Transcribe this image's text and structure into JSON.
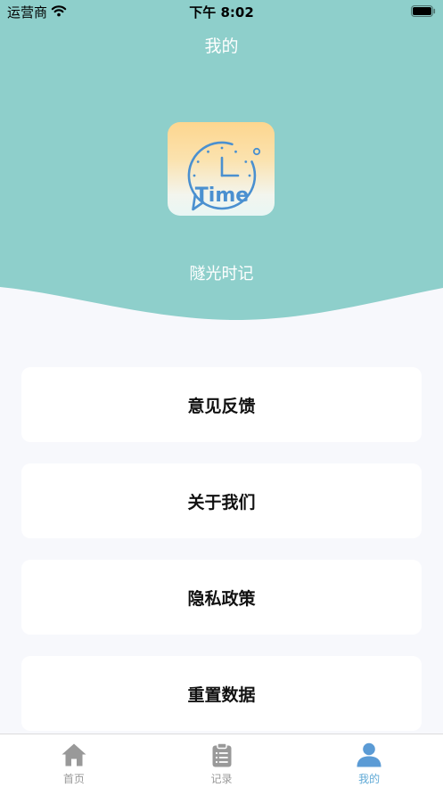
{
  "status_bar": {
    "carrier": "运营商",
    "time": "下午 8:02",
    "battery_level": 1.0,
    "icons": [
      "wifi-icon",
      "battery-icon"
    ]
  },
  "header": {
    "title": "我的"
  },
  "profile": {
    "logo_text": "Time",
    "app_name": "隧光时记"
  },
  "menu": {
    "items": [
      {
        "label": "意见反馈"
      },
      {
        "label": "关于我们"
      },
      {
        "label": "隐私政策"
      },
      {
        "label": "重置数据"
      }
    ]
  },
  "tab_bar": {
    "tabs": [
      {
        "label": "首页",
        "icon": "home-icon",
        "active": false
      },
      {
        "label": "记录",
        "icon": "clipboard-icon",
        "active": false
      },
      {
        "label": "我的",
        "icon": "user-icon",
        "active": true
      }
    ]
  },
  "colors": {
    "header_bg": "#8ecfcb",
    "page_bg": "#f7f8fc",
    "logo_blue": "#4a90d0",
    "tab_active_icon": "#5b9bd5",
    "tab_active_label": "#5fa9d6",
    "tab_inactive": "#999999"
  }
}
